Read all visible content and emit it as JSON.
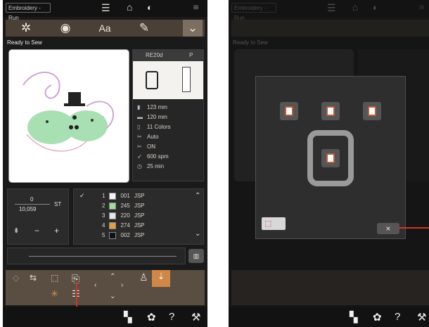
{
  "app_title": "Embroidery - Run",
  "tabs": [
    {
      "name": "embroidery-icon",
      "glyph": "✲"
    },
    {
      "name": "design-icon",
      "glyph": "◉"
    },
    {
      "name": "text-icon",
      "glyph": "Aa"
    },
    {
      "name": "edit-icon",
      "glyph": "✎"
    },
    {
      "name": "chevron-down-icon",
      "glyph": "⌄"
    }
  ],
  "status_text": "Ready to Sew",
  "info": {
    "hoop": "RE20d",
    "foot": "P",
    "width": "123 mm",
    "height": "120 mm",
    "colors": "11 Colors",
    "cut": "Auto",
    "speed_mode": "ON",
    "speed": "600 spm",
    "time": "25 min"
  },
  "stitch": {
    "current": "0",
    "total": "10,059",
    "unit": "ST"
  },
  "color_list": [
    {
      "num": "1",
      "code": "001",
      "brand": "JSP",
      "hex": "#f4f4f4"
    },
    {
      "num": "2",
      "code": "245",
      "brand": "JSP",
      "hex": "#9fdc9a"
    },
    {
      "num": "3",
      "code": "220",
      "brand": "JSP",
      "hex": "#e6e6e6"
    },
    {
      "num": "4",
      "code": "274",
      "brand": "JSP",
      "hex": "#e0a040"
    },
    {
      "num": "5",
      "code": "002",
      "brand": "JSP",
      "hex": "#111111"
    }
  ],
  "colors_accent": {
    "tab_bg": "#4a4036",
    "bottom_bg": "#5a4e42",
    "highlight": "#c05a34",
    "callout": "#d0342c"
  },
  "dialog_close": "×"
}
